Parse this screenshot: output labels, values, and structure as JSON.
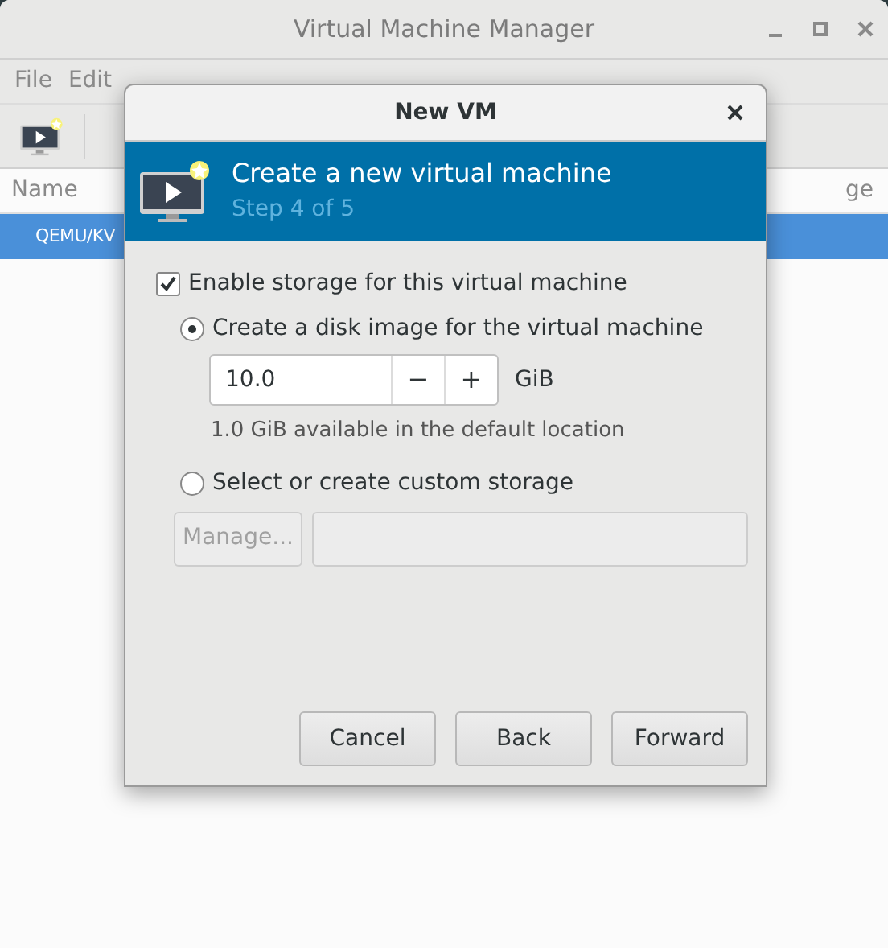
{
  "main_window": {
    "title": "Virtual Machine Manager",
    "menu": [
      "File",
      "Edit"
    ],
    "columns": [
      "Name",
      "ge"
    ],
    "rows": [
      {
        "label": "QEMU/KV",
        "selected": true
      }
    ]
  },
  "dialog": {
    "title": "New VM",
    "banner": {
      "title": "Create a new virtual machine",
      "subtitle": "Step 4 of 5"
    },
    "enable_storage": {
      "label": "Enable storage for this virtual machine",
      "checked": true
    },
    "options": [
      {
        "label": "Create a disk image for the virtual machine",
        "selected": true
      },
      {
        "label": "Select or create custom storage",
        "selected": false
      }
    ],
    "size": {
      "value": "10.0",
      "minus": "−",
      "plus": "+",
      "unit": "GiB"
    },
    "available": "1.0 GiB available in the default location",
    "manage": {
      "label": "Manage...",
      "disabled": true
    },
    "buttons": [
      "Cancel",
      "Back",
      "Forward"
    ]
  }
}
